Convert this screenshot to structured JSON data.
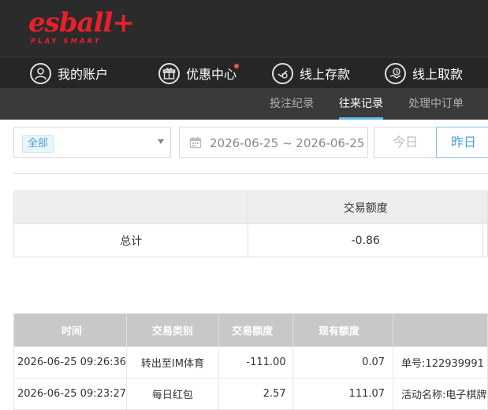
{
  "header": {
    "logo_text": "esball+",
    "logo_tagline": "PLAY SMART",
    "brand_color": "#e8202a"
  },
  "nav": {
    "items": [
      {
        "label": "我的账户",
        "icon": "user-icon"
      },
      {
        "label": "优惠中心",
        "icon": "gift-icon",
        "badge_dot": true
      },
      {
        "label": "线上存款",
        "icon": "deposit-icon"
      },
      {
        "label": "线上取款",
        "icon": "withdraw-icon"
      }
    ]
  },
  "subnav": {
    "tabs": [
      {
        "label": "投注纪录",
        "active": false
      },
      {
        "label": "往来记录",
        "active": true
      },
      {
        "label": "处理中订单",
        "active": false
      }
    ],
    "accent_color": "#5cb8e6"
  },
  "filters": {
    "type_select_value": "全部",
    "date_range": "2026-06-25 ~ 2026-06-25",
    "today_label": "今日",
    "yesterday_label": "昨日"
  },
  "summary": {
    "header": "交易额度",
    "total_label": "总计",
    "total_value": "-0.86"
  },
  "records": {
    "columns": [
      "时间",
      "交易类别",
      "交易额度",
      "现有额度",
      ""
    ],
    "rows": [
      {
        "time": "2026-06-25 09:26:36",
        "type": "转出至IM体育",
        "amount": "-111.00",
        "balance": "0.07",
        "memo": "单号:122939991"
      },
      {
        "time": "2026-06-25 09:23:27",
        "type": "每日红包",
        "amount": "2.57",
        "balance": "111.07",
        "memo": "活动名称:电子棋牌"
      }
    ]
  }
}
